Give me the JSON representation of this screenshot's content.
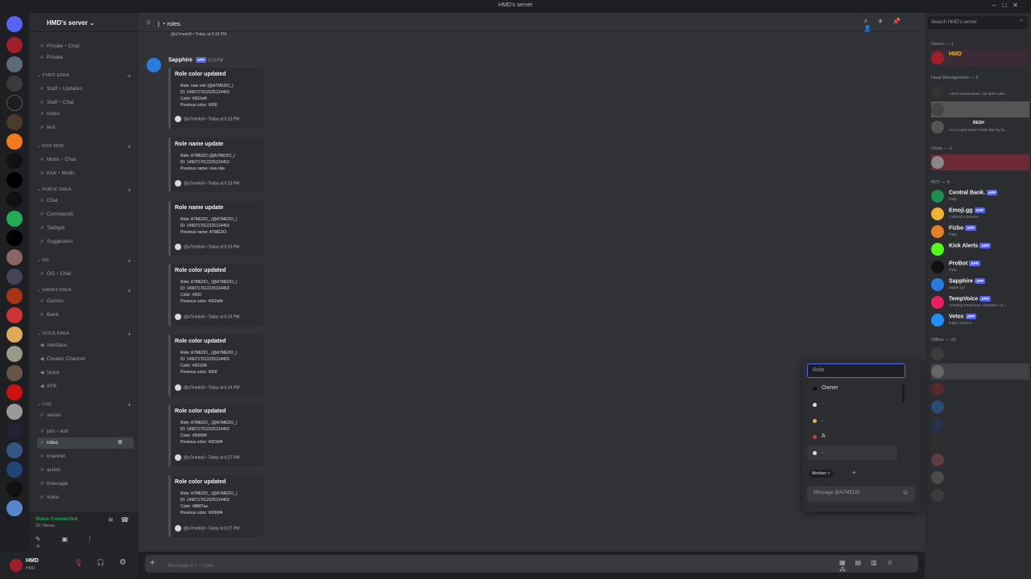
{
  "window": {
    "title": "HMD's server"
  },
  "server": {
    "name": "HMD's server"
  },
  "categories": [
    {
      "label": "STAFF EREA",
      "channels": [
        {
          "label": "Staff・Updates"
        },
        {
          "label": "Staff・Chat"
        },
        {
          "label": "notes"
        },
        {
          "label": "test"
        }
      ]
    },
    {
      "label": "KICK MOD",
      "channels": [
        {
          "label": "Mods・Chat"
        },
        {
          "label": "Kick・Mods"
        }
      ]
    },
    {
      "label": "PUBLIC EREA",
      "channels": [
        {
          "label": "Chat"
        },
        {
          "label": "Commands"
        },
        {
          "label": "Takligat"
        },
        {
          "label": "Suggestion"
        }
      ]
    },
    {
      "label": "OG",
      "channels": [
        {
          "label": "OG・Chat"
        }
      ]
    },
    {
      "label": "GAMES EREA",
      "channels": [
        {
          "label": "Games"
        },
        {
          "label": "Bank"
        }
      ]
    },
    {
      "label": "VOICE EREA",
      "channels": [
        {
          "label": "interface"
        },
        {
          "label": "Creator Channel"
        },
        {
          "label": "Voice"
        },
        {
          "label": "AFK"
        }
      ]
    },
    {
      "label": "LOG",
      "channels": [
        {
          "label": "server"
        },
        {
          "label": "join・exit"
        },
        {
          "label": "roles"
        },
        {
          "label": "channel"
        },
        {
          "label": "action"
        },
        {
          "label": "massage"
        },
        {
          "label": "voice"
        }
      ]
    }
  ],
  "top_channels": [
    {
      "label": "Private・Chat"
    },
    {
      "label": "Private"
    }
  ],
  "voice": {
    "status": "Voice Connected",
    "channel": "10 / Nexus"
  },
  "user": {
    "name": "HMD",
    "tag": "HMD"
  },
  "chat_header": {
    "channel": "roles"
  },
  "message": {
    "author": "Sapphire",
    "bot_tag": "APP",
    "time": "6:23 PM",
    "prev_footer": "@a7medo8 • Today at 6:19 PM",
    "embeds": [
      {
        "title": "Role color updated",
        "lines": [
          "Role: new role (@A7MEDO_)",
          "ID: 1490717612225124453",
          "Color: #002af4",
          "Previous color: #000"
        ],
        "footer": "@a7medo8 • Today at 6:23 PM"
      },
      {
        "title": "Role name update",
        "lines": [
          "Role: A7MEDO (@A7MEDO_)",
          "ID: 1490717612225124453",
          "Previous name: new role"
        ],
        "footer": "@a7medo8 • Today at 6:23 PM"
      },
      {
        "title": "Role name update",
        "lines": [
          "Role: A7MEDO_ (@A7MEDO_)",
          "ID: 1490717612225124453",
          "Previous name: A7MEDO"
        ],
        "footer": "@a7medo8 • Today at 6:23 PM"
      },
      {
        "title": "Role color updated",
        "lines": [
          "Role: A7MEDO_ (@A7MEDO_)",
          "ID: 1490717612225124453",
          "Color: #000",
          "Previous color: #002af4"
        ],
        "footer": "@a7medo8 • Today at 6:24 PM"
      },
      {
        "title": "Role color updated",
        "lines": [
          "Role: A7MEDO_ (@A7MEDO_)",
          "ID: 1490717612225124453",
          "Color: #0016f4",
          "Previous color: #000"
        ],
        "footer": "@a7medo8 • Today at 6:24 PM"
      },
      {
        "title": "Role color updated",
        "lines": [
          "Role: A7MEDO_ (@A7MEDO_)",
          "ID: 1490717612225124453",
          "Color: #0066f4",
          "Previous color: #0016f4"
        ],
        "footer": "@a7medo8 • Today at 6:27 PM"
      },
      {
        "title": "Role color updated",
        "lines": [
          "Role: A7MEDO_ (@A7MEDO_)",
          "ID: 1490717612225124453",
          "Color: #8887ae",
          "Previous color: #0066f4"
        ],
        "footer": "@a7medo8 • Today at 6:27 PM"
      }
    ]
  },
  "composer": {
    "placeholder": "Message # | ・roles"
  },
  "members": {
    "search_placeholder": "Search HMD's server",
    "groups": [
      {
        "label": "Owner — 1",
        "items": [
          {
            "name": "HMD",
            "status": ""
          }
        ]
      },
      {
        "label": "Head Management — 3",
        "items": [
          {
            "name": "",
            "status": "I don't wanna leave, but that's wha..."
          },
          {
            "name": "",
            "status": ""
          },
          {
            "name": "BESH",
            "status": "I'm so hard when it feels like my fa..."
          }
        ]
      },
      {
        "label": "Close — 1",
        "items": [
          {
            "name": "",
            "status": ""
          }
        ]
      },
      {
        "label": "BOT — 8",
        "items": [
          {
            "name": "Central Bank.",
            "status": "/help",
            "badge": "APP"
          },
          {
            "name": "Emoji.gg",
            "status": "1,355,914 Servers",
            "badge": "APP"
          },
          {
            "name": "Fizbo",
            "status": "/help",
            "badge": "APP"
          },
          {
            "name": "Kick Alerts",
            "status": "",
            "badge": "APP"
          },
          {
            "name": "ProBot",
            "status": "/help",
            "badge": "APP"
          },
          {
            "name": "Sapphire",
            "status": "sapph.xyz",
            "badge": "APP"
          },
          {
            "name": "TempVoice",
            "status": "Creating Temporary Channels • /h...",
            "badge": "APP"
          },
          {
            "name": "Vetox",
            "status": "/help | vetox.io",
            "badge": "APP"
          }
        ]
      },
      {
        "label": "Offline — 10",
        "items": []
      }
    ]
  },
  "role_popup": {
    "input_placeholder": "Role",
    "options": [
      {
        "label": "Owner",
        "color": "#2b2d31"
      },
      {
        "label": "·",
        "color": "#dbdee1"
      },
      {
        "label": ".",
        "color": "#f0b232"
      },
      {
        "label": "A",
        "color": "#da373c"
      },
      {
        "label": ".",
        "color": "#dbdee1"
      }
    ],
    "chip_label": "Member",
    "dm_placeholder": "Message @A7MEDO"
  },
  "colors": {
    "accent": "#5865f2",
    "green": "#23a55a",
    "background": "#313338"
  }
}
